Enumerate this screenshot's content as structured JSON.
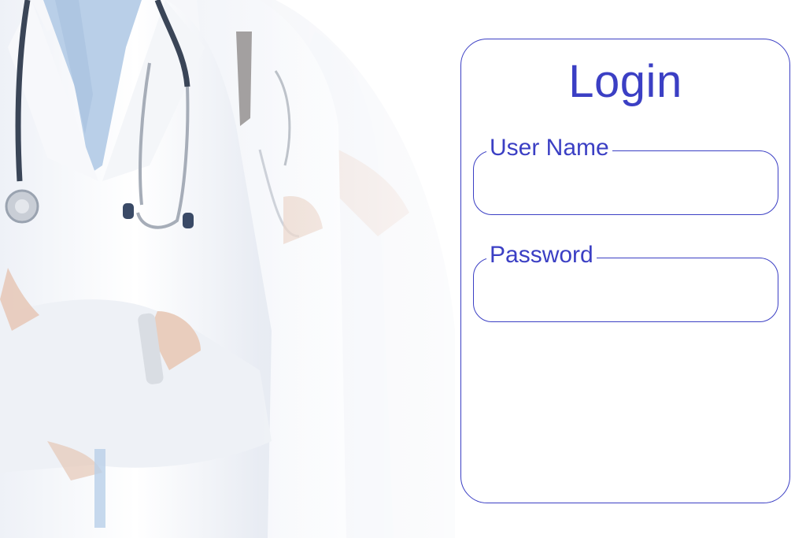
{
  "hero": {
    "image": "doctors-in-white-coats-with-stethoscopes"
  },
  "login": {
    "title": "Login",
    "username_label": "User Name",
    "username_value": "",
    "password_label": "Password",
    "password_value": ""
  },
  "colors": {
    "accent": "#3b3fc4",
    "background": "#ffffff"
  }
}
